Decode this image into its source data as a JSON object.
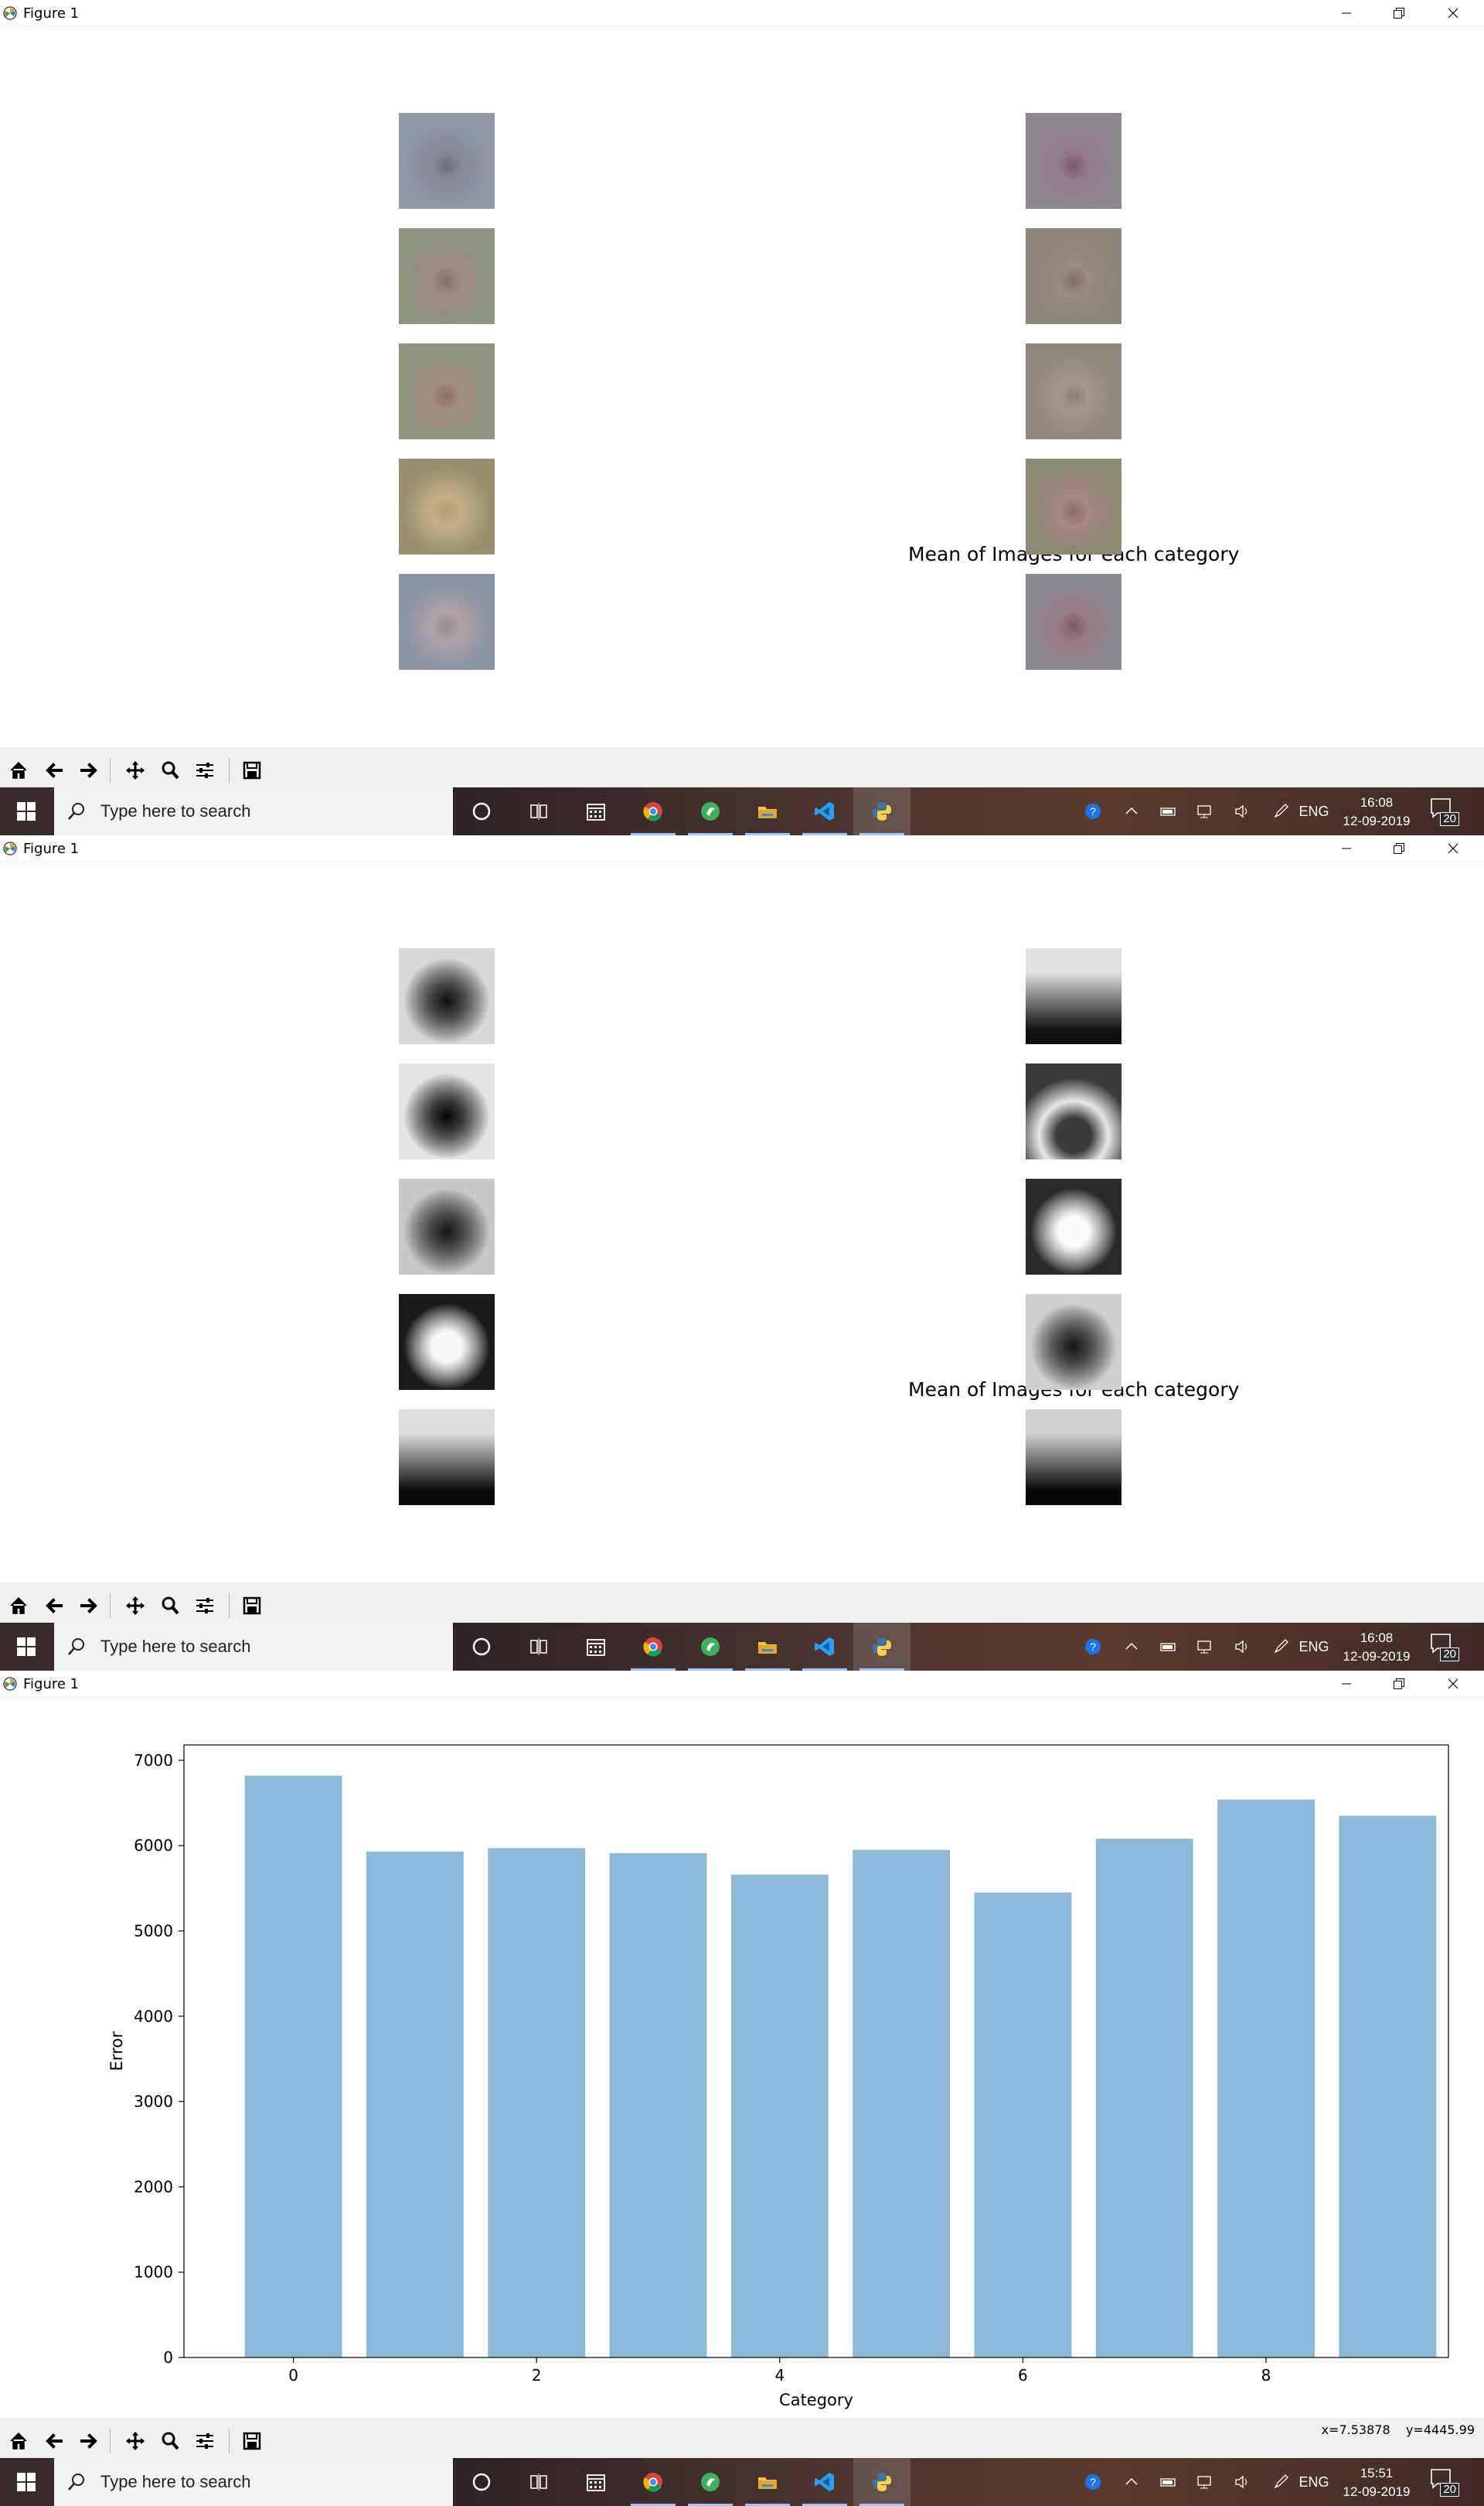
{
  "window": {
    "title": "Figure 1"
  },
  "screen1": {
    "figure_title": "Mean of Images for each category",
    "left_thumbs": [
      {
        "bg": "#8f9aa6",
        "blob": "#6b6f7c"
      },
      {
        "bg": "#8e9580",
        "blob": "#886e6c"
      },
      {
        "bg": "#8f9480",
        "blob": "#8d6f6a"
      },
      {
        "bg": "#9a9070",
        "blob": "#b49c6b"
      },
      {
        "bg": "#8a95a6",
        "blob": "#9a8c90"
      }
    ],
    "right_thumbs": [
      {
        "bg": "#8d8890",
        "blob": "#7a5a6a"
      },
      {
        "bg": "#8a8478",
        "blob": "#7e7068"
      },
      {
        "bg": "#8f887c",
        "blob": "#887e76"
      },
      {
        "bg": "#8c8a72",
        "blob": "#8f6a6a"
      },
      {
        "bg": "#8c8890",
        "blob": "#7d5a66"
      }
    ]
  },
  "screen2": {
    "figure_title": "Mean of Images for each category",
    "left_thumbs": [
      {
        "bg": "#d8d8d8",
        "blob": "#111111",
        "mode": "dark-blob"
      },
      {
        "bg": "#e4e4e4",
        "blob": "#050505",
        "mode": "dark-blob"
      },
      {
        "bg": "#c8c8c8",
        "blob": "#151515",
        "mode": "dark-blob"
      },
      {
        "bg": "#1a1a1a",
        "blob": "#f5f5f5",
        "mode": "light-blob"
      },
      {
        "bg": "#dddddd",
        "blob": "#0a0a0a",
        "mode": "bottom-dark"
      }
    ],
    "right_thumbs": [
      {
        "bg": "#e0e0e0",
        "blob": "#101010",
        "mode": "bottom-dark"
      },
      {
        "bg": "#3a3a3a",
        "blob": "#e8e8e8",
        "mode": "arch"
      },
      {
        "bg": "#2a2a2a",
        "blob": "#fafafa",
        "mode": "light-blob"
      },
      {
        "bg": "#cfcfcf",
        "blob": "#141414",
        "mode": "dark-blob"
      },
      {
        "bg": "#d0d0d0",
        "blob": "#080808",
        "mode": "bottom-dark"
      }
    ]
  },
  "screen3": {
    "coords": "x=7.53878    y=4445.99"
  },
  "toolbar": {
    "icons": [
      "home-icon",
      "back-arrow-icon",
      "forward-arrow-icon",
      "pan-icon",
      "zoom-icon",
      "configure-subplots-icon",
      "save-icon"
    ]
  },
  "taskbar": {
    "search_placeholder": "Type here to search",
    "language": "ENG",
    "notifications": "20",
    "clock": [
      {
        "time": "16:08",
        "date": "12-09-2019"
      },
      {
        "time": "16:08",
        "date": "12-09-2019"
      },
      {
        "time": "15:51",
        "date": "12-09-2019"
      }
    ]
  },
  "colors": {
    "bar": "#8cb8d9",
    "taskbar": "#3a2c2b",
    "toolbar": "#f0f0f0"
  },
  "chart_data": {
    "type": "bar",
    "categories": [
      0,
      1,
      2,
      3,
      4,
      5,
      6,
      7,
      8,
      9
    ],
    "values": [
      6820,
      5930,
      5970,
      5910,
      5660,
      5950,
      5450,
      6080,
      6540,
      6350
    ],
    "title": "",
    "xlabel": "Category",
    "ylabel": "Error",
    "ylim": [
      0,
      7180
    ],
    "xlim": [
      -0.9,
      9.5
    ],
    "yticks": [
      0,
      1000,
      2000,
      3000,
      4000,
      5000,
      6000,
      7000
    ],
    "xticks": [
      0,
      2,
      4,
      6,
      8
    ],
    "grid": false
  }
}
